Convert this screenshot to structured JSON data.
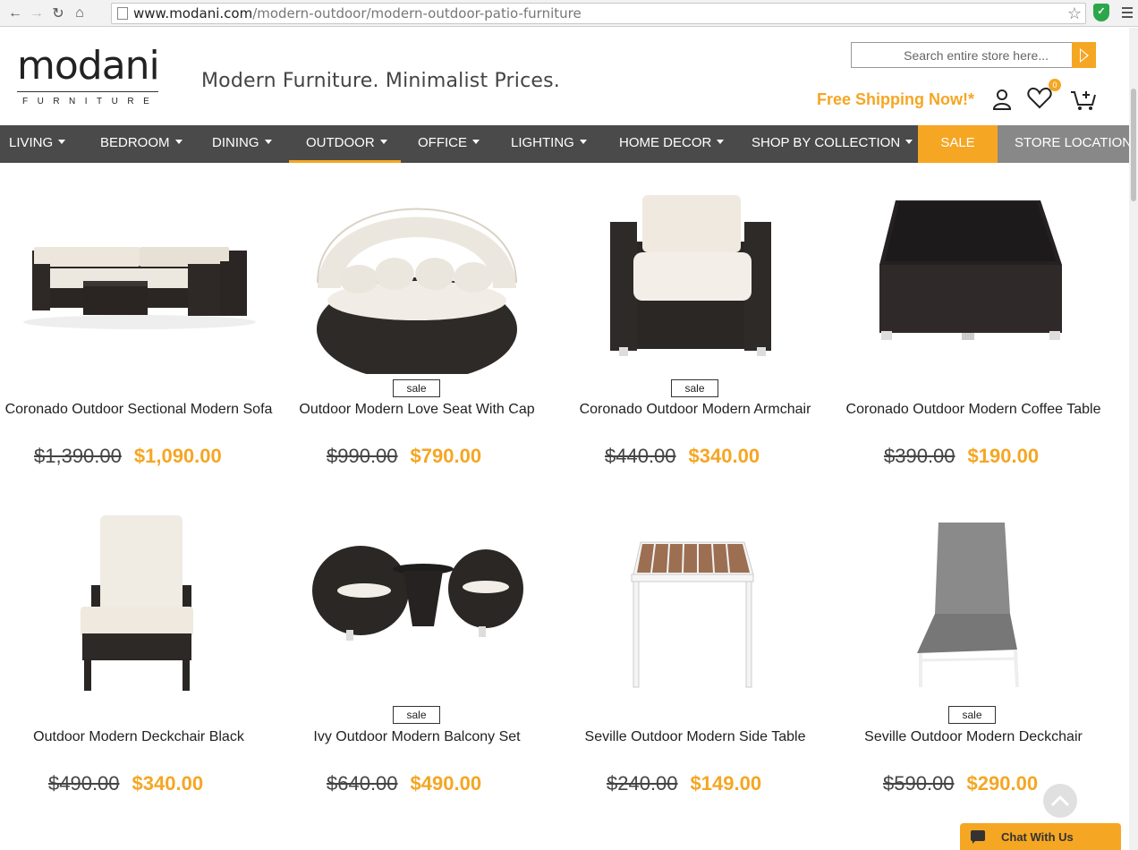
{
  "browser": {
    "url_host": "www.modani.com",
    "url_path": "/modern-outdoor/modern-outdoor-patio-furniture"
  },
  "header": {
    "logo_word": "modani",
    "logo_sub": "FURNITURE",
    "tagline": "Modern Furniture. Minimalist Prices.",
    "search_placeholder": "Search entire store here...",
    "free_shipping": "Free Shipping Now!*",
    "wishlist_count": "0"
  },
  "nav": {
    "items": [
      "LIVING",
      "BEDROOM",
      "DINING",
      "OUTDOOR",
      "OFFICE",
      "LIGHTING",
      "HOME DECOR",
      "SHOP BY COLLECTION"
    ],
    "active": "OUTDOOR",
    "sale": "SALE",
    "stores": "STORE LOCATIONS"
  },
  "products": [
    {
      "name": "Coronado Outdoor Sectional Modern Sofa",
      "old_price": "$1,390.00",
      "new_price": "$1,090.00",
      "sale": false
    },
    {
      "name": "Outdoor Modern Love Seat With Cap",
      "old_price": "$990.00",
      "new_price": "$790.00",
      "sale": true
    },
    {
      "name": "Coronado Outdoor Modern Armchair",
      "old_price": "$440.00",
      "new_price": "$340.00",
      "sale": true
    },
    {
      "name": "Coronado Outdoor Modern Coffee Table",
      "old_price": "$390.00",
      "new_price": "$190.00",
      "sale": false
    },
    {
      "name": "Outdoor Modern Deckchair Black",
      "old_price": "$490.00",
      "new_price": "$340.00",
      "sale": false
    },
    {
      "name": "Ivy Outdoor Modern Balcony Set",
      "old_price": "$640.00",
      "new_price": "$490.00",
      "sale": true
    },
    {
      "name": "Seville Outdoor Modern Side Table",
      "old_price": "$240.00",
      "new_price": "$149.00",
      "sale": false
    },
    {
      "name": "Seville Outdoor Modern Deckchair",
      "old_price": "$590.00",
      "new_price": "$290.00",
      "sale": true
    }
  ],
  "sale_label": "sale",
  "chat": {
    "label": "Chat With Us"
  },
  "colors": {
    "accent": "#f5a623",
    "nav_bg": "#4a4a4a",
    "stores_bg": "#888888"
  }
}
